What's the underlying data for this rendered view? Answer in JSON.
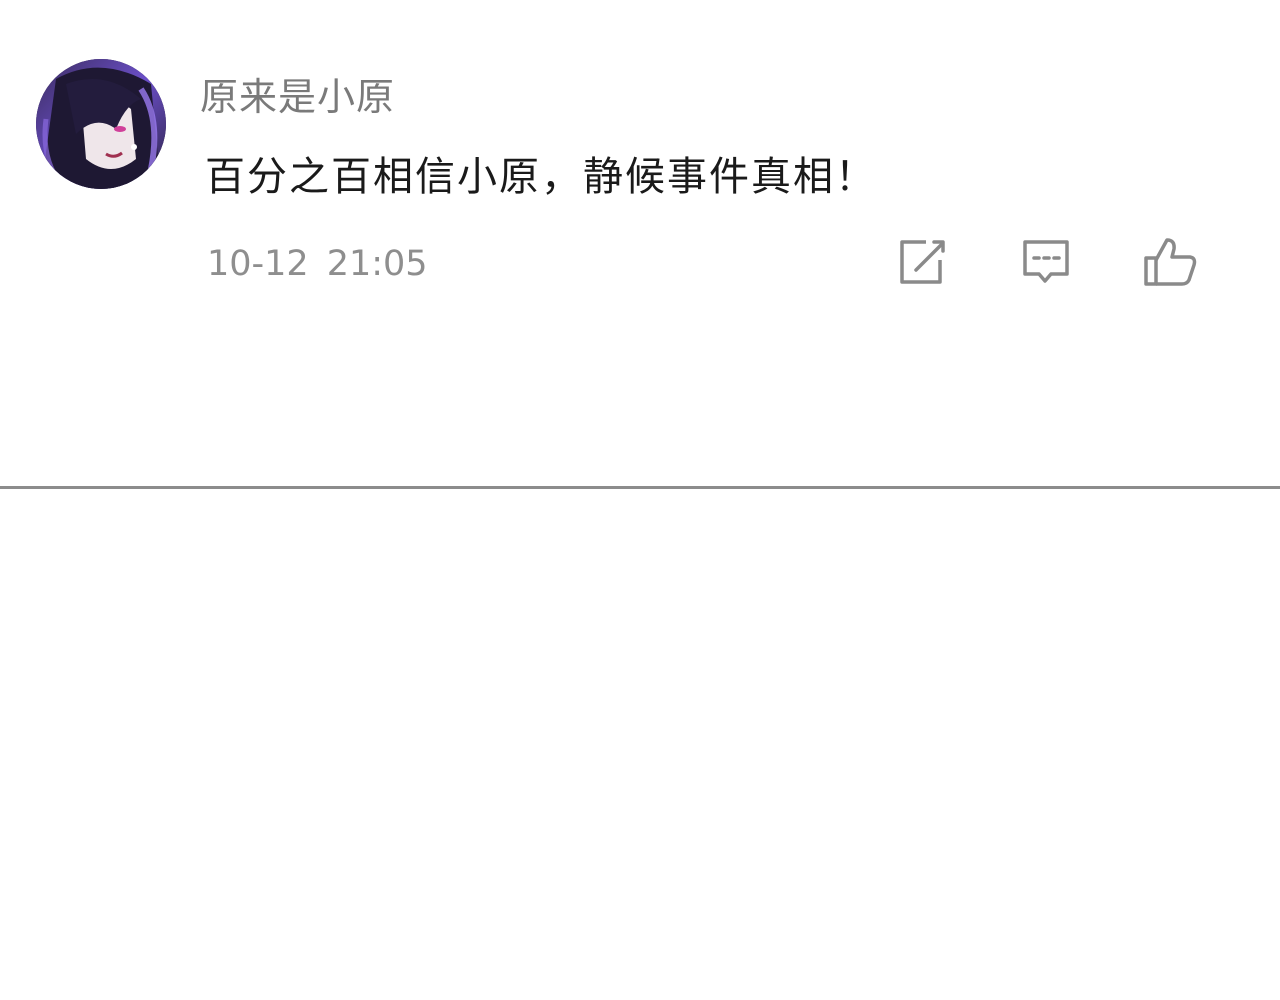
{
  "comment": {
    "avatar_icon": "user-avatar",
    "username": "原来是小原",
    "text": "百分之百相信小原，静候事件真相！",
    "date": "10-12",
    "time": "21:05",
    "actions": {
      "share_icon": "share-edit-icon",
      "reply_icon": "comment-bubble-icon",
      "like_icon": "thumbs-up-icon"
    }
  },
  "colors": {
    "username": "#7a7a7a",
    "text": "#1a1a1a",
    "meta": "#8e8e8e",
    "icon": "#8a8a8a",
    "divider": "#8c8c8c",
    "avatar_accent": "#7b4fd6"
  }
}
